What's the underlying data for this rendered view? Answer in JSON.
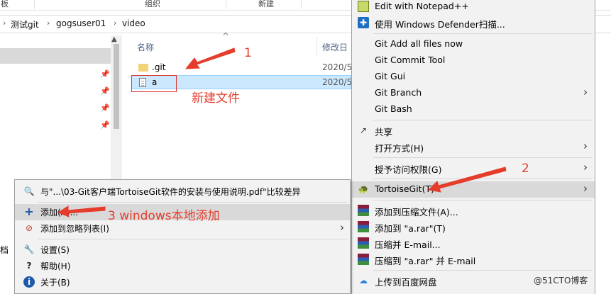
{
  "ribbon": {
    "labels": [
      "板",
      "组织",
      "新建"
    ]
  },
  "address": {
    "crumbs": [
      "测试git",
      "gogsuser01",
      "video"
    ]
  },
  "navpane": {
    "left_edge_char": "档"
  },
  "filelist": {
    "columns": {
      "name": "名称",
      "modified": "修改日"
    },
    "rows": [
      {
        "name": ".git",
        "date": "2020/5"
      },
      {
        "name": "a",
        "date": "2020/5"
      }
    ]
  },
  "annotations": {
    "step1": "1",
    "new_file": "新建文件",
    "step2": "2",
    "step3": "3  windows本地添加"
  },
  "context_menu": {
    "items": [
      {
        "label": "Edit with Notepad++"
      },
      {
        "label": "使用 Windows Defender扫描..."
      },
      {
        "label": "Git Add all files now"
      },
      {
        "label": "Git Commit Tool"
      },
      {
        "label": "Git Gui"
      },
      {
        "label": "Git Branch"
      },
      {
        "label": "Git Bash"
      },
      {
        "label": "共享"
      },
      {
        "label": "打开方式(H)"
      },
      {
        "label": "授予访问权限(G)"
      },
      {
        "label": "TortoiseGit(T)"
      },
      {
        "label": "添加到压缩文件(A)..."
      },
      {
        "label": "添加到 \"a.rar\"(T)"
      },
      {
        "label": "压缩并 E-mail..."
      },
      {
        "label": "压缩到 \"a.rar\" 并 E-mail"
      },
      {
        "label": "上传到百度网盘"
      }
    ]
  },
  "tortoise_submenu": {
    "items": [
      {
        "label": "与\"...\\03-Git客户端TortoiseGit软件的安装与使用说明.pdf\"比较差异"
      },
      {
        "label": "添加(A)..."
      },
      {
        "label": "添加到忽略列表(I)"
      },
      {
        "label": "设置(S)"
      },
      {
        "label": "帮助(H)"
      },
      {
        "label": "关于(B)"
      }
    ]
  },
  "watermark": "@51CTO博客",
  "colors": {
    "annotation_red": "#e53c2c",
    "selection_blue": "#cce8ff",
    "menu_bg": "#f2f2f2"
  }
}
